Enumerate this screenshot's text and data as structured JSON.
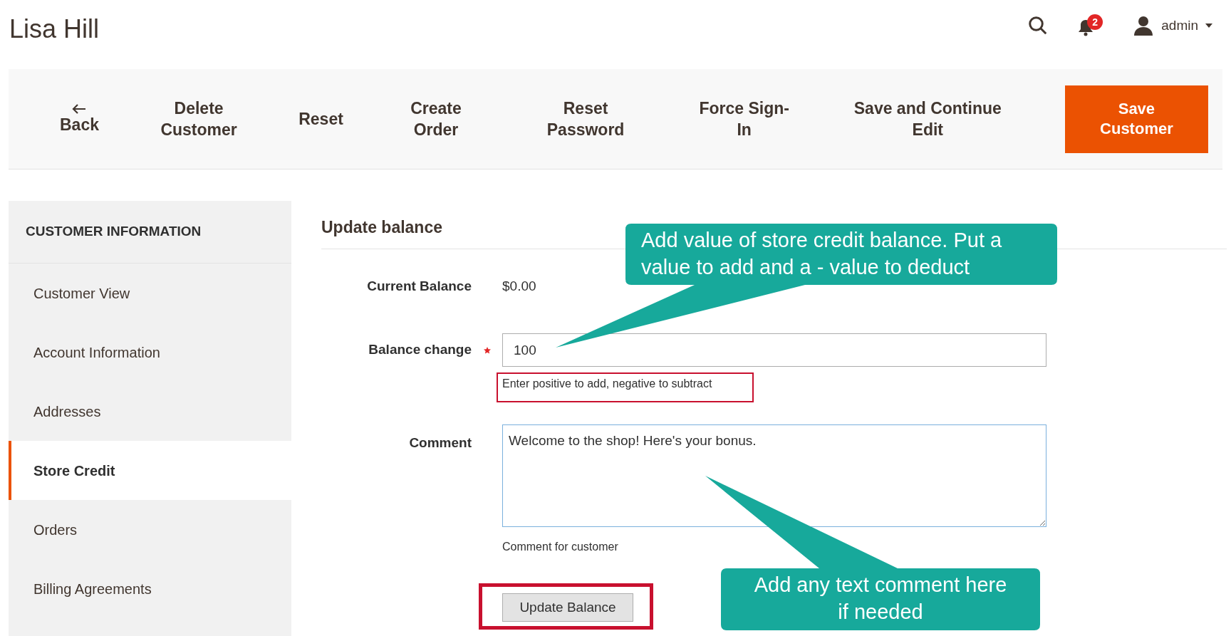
{
  "header": {
    "title": "Lisa Hill",
    "notifications": "2",
    "user": "admin"
  },
  "toolbar": {
    "buttons": [
      {
        "label": "Back",
        "kind": "back"
      },
      {
        "label": "Delete Customer",
        "kind": "plain"
      },
      {
        "label": "Reset",
        "kind": "plain"
      },
      {
        "label": "Create Order",
        "kind": "plain"
      },
      {
        "label": "Reset Password",
        "kind": "plain"
      },
      {
        "label": "Force Sign-In",
        "kind": "plain"
      },
      {
        "label": "Save and Continue Edit",
        "kind": "plain"
      },
      {
        "label": "Save Customer",
        "kind": "primary"
      }
    ]
  },
  "sidebar": {
    "heading": "CUSTOMER INFORMATION",
    "items": [
      {
        "label": "Customer View",
        "selected": false
      },
      {
        "label": "Account Information",
        "selected": false
      },
      {
        "label": "Addresses",
        "selected": false
      },
      {
        "label": "Store Credit",
        "selected": true
      },
      {
        "label": "Orders",
        "selected": false
      },
      {
        "label": "Billing Agreements",
        "selected": false
      }
    ]
  },
  "form": {
    "title": "Update balance",
    "fields": [
      {
        "kind": "static",
        "label": "Current Balance",
        "value": "$0.00"
      },
      {
        "kind": "input",
        "label": "Balance change",
        "required": true,
        "value": "100",
        "hint": "Enter positive to add, negative to subtract",
        "highlighted": true
      },
      {
        "kind": "textarea",
        "label": "Comment",
        "value": "Welcome to the shop! Here's your bonus.",
        "hint": "Comment for customer"
      }
    ],
    "button": {
      "label": "Update Balance",
      "highlighted": true
    }
  },
  "annotations": [
    {
      "lines": [
        "Add value of store credit balance. Put a",
        "value to add and a - value to deduct"
      ]
    },
    {
      "lines": [
        "Add any text comment here",
        "if needed"
      ]
    }
  ]
}
